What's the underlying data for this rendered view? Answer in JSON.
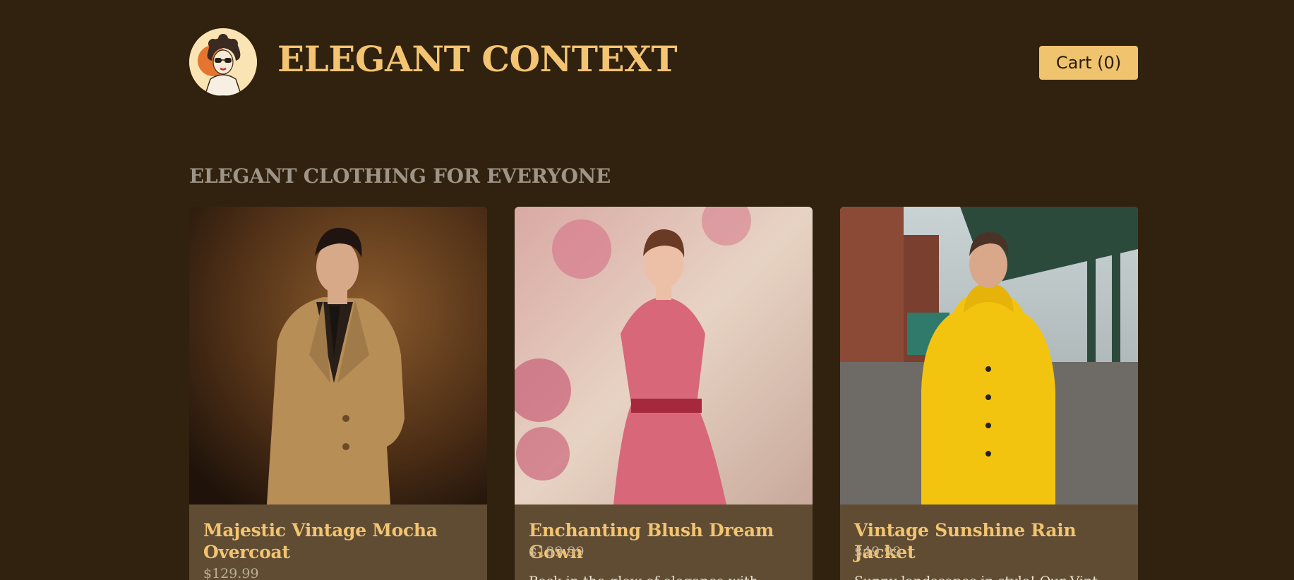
{
  "header": {
    "brand": "ELEGANT CONTEXT",
    "cart_label": "Cart (0)",
    "logo_icon": "vintage-woman-sunglasses-logo"
  },
  "section": {
    "title": "ELEGANT CLOTHING FOR EVERYONE"
  },
  "products": [
    {
      "name": "Majestic Vintage Mocha Overcoat",
      "price": "$129.99",
      "description": "",
      "image": "man-in-beige-trench-coat"
    },
    {
      "name": "Enchanting Blush Dream Gown",
      "price": "$189.99",
      "description": "Bask in the glow of elegance with",
      "image": "woman-in-pink-dress"
    },
    {
      "name": "Vintage Sunshine Rain Jacket",
      "price": "$49.99",
      "description": "Sunny landscapes in style! Our Vint",
      "image": "man-in-yellow-raincoat"
    }
  ],
  "colors": {
    "background": "#31220f",
    "accent": "#f3c471",
    "card": "#5f4c33",
    "section_title": "#9e9588"
  }
}
